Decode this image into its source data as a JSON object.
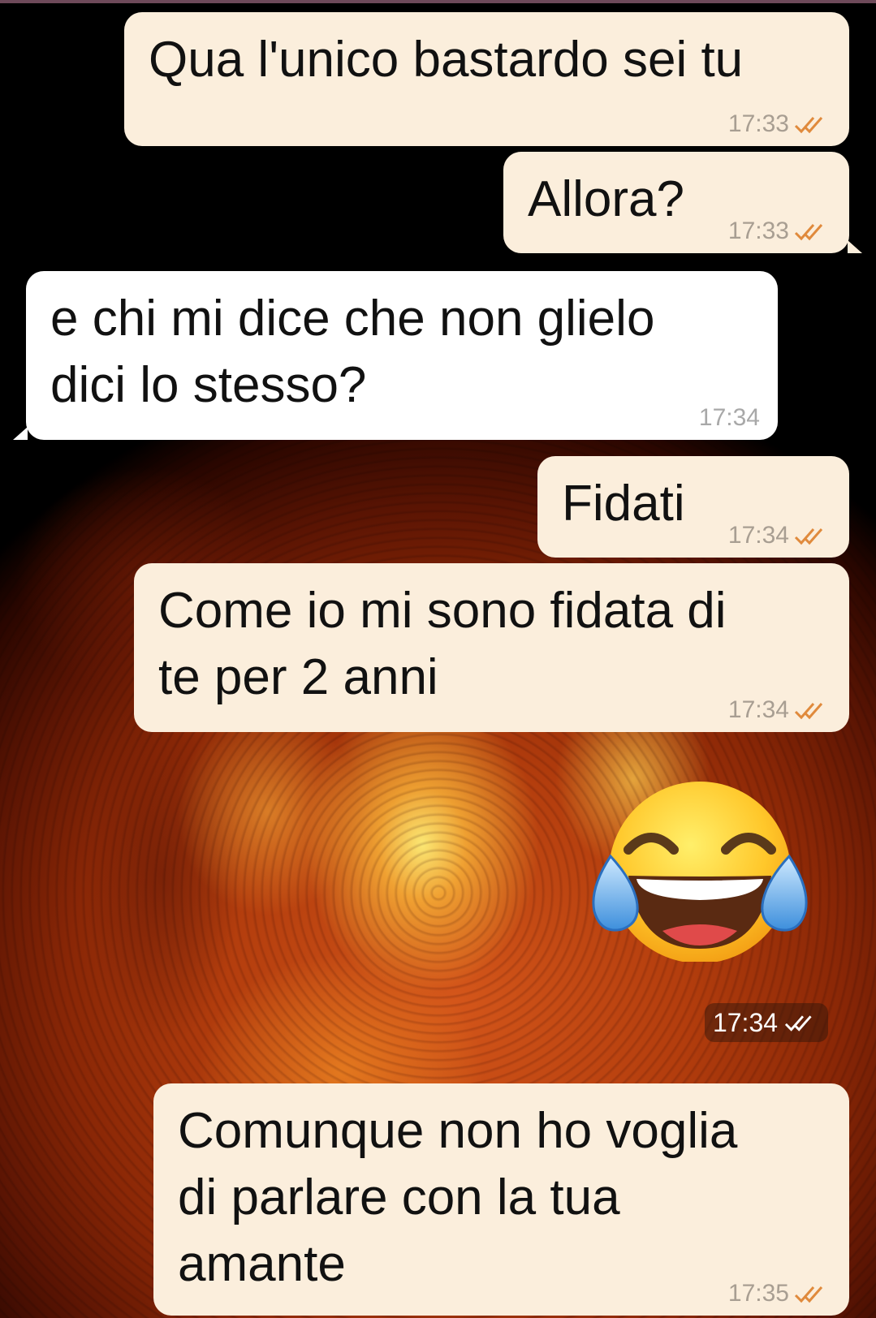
{
  "messages": [
    {
      "text": "Qua l'unico bastardo sei tu",
      "time": "17:33",
      "direction": "out",
      "status": "read-double-check"
    },
    {
      "text": "Allora?",
      "time": "17:33",
      "direction": "out",
      "status": "read-double-check"
    },
    {
      "text": "e chi mi dice che non glielo\ndici lo stesso?",
      "time": "17:34",
      "direction": "in"
    },
    {
      "text": "Fidati",
      "time": "17:34",
      "direction": "out",
      "status": "read-double-check"
    },
    {
      "text": "Come io mi sono fidata di\nte per 2 anni",
      "time": "17:34",
      "direction": "out",
      "status": "read-double-check"
    },
    {
      "emoji": "face-with-tears-of-joy",
      "time": "17:34",
      "direction": "out",
      "status": "read-double-check"
    },
    {
      "text": "Comunque non ho voglia\ndi parlare con la tua\namante",
      "time": "17:35",
      "direction": "out",
      "status": "read-double-check"
    }
  ],
  "colors": {
    "outgoing_bubble": "#fbeedc",
    "incoming_bubble": "#ffffff",
    "timestamp": "#a89e92",
    "read_ticks": "#e08a3c",
    "wallpaper": "sun-surface-orange"
  }
}
